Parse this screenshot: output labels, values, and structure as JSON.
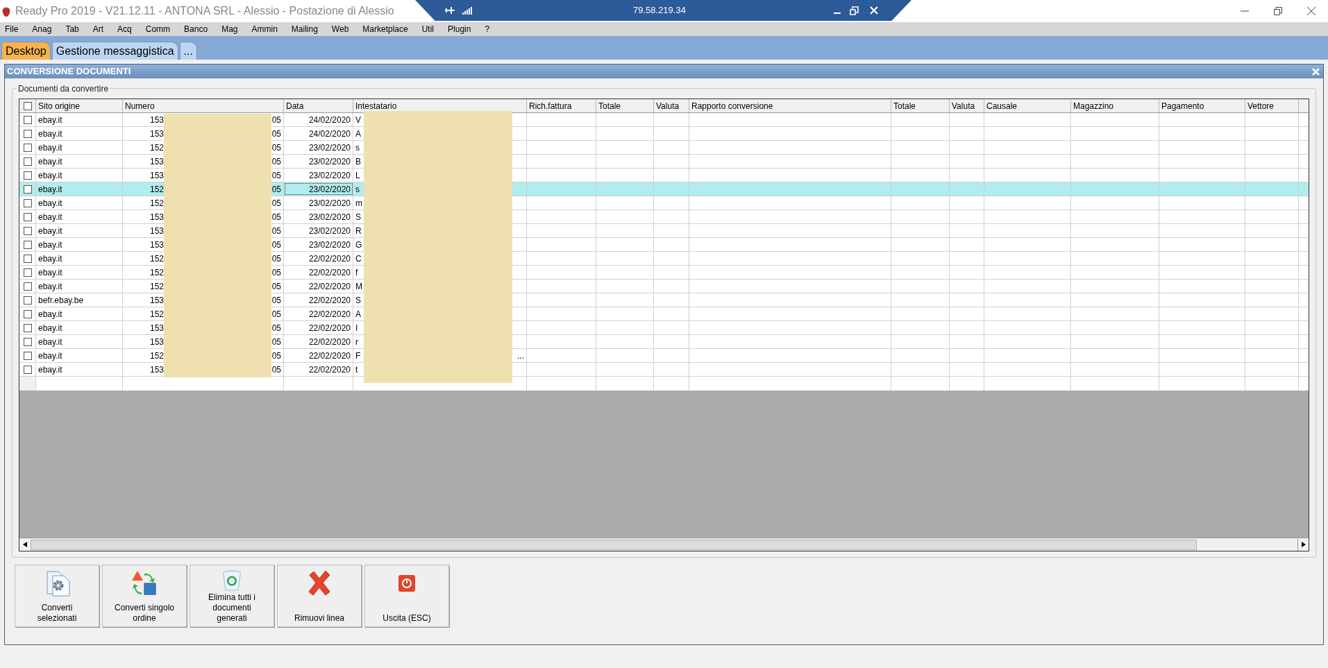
{
  "window": {
    "title": "Ready Pro 2019 - V21.12.11 - ANTONA SRL - Alessio - Postazione di Alessio"
  },
  "remote_bar": {
    "address": "79.58.219.34"
  },
  "menu": [
    "File",
    "Anag",
    "Tab",
    "Art",
    "Acq",
    "Comm",
    "Banco",
    "Mag",
    "Ammin",
    "Mailing",
    "Web",
    "Marketplace",
    "Util",
    "Plugin",
    "?"
  ],
  "tabs": [
    {
      "label": "Desktop",
      "selected": true
    },
    {
      "label": "Gestione messaggistica",
      "selected": false
    },
    {
      "label": "...",
      "selected": false
    }
  ],
  "panel": {
    "title": "CONVERSIONE DOCUMENTI",
    "group_label": "Documenti da convertire"
  },
  "table": {
    "header_checked": false,
    "columns": [
      "Sito origine",
      "Numero",
      "Data",
      "Intestatario",
      "Rich.fattura",
      "Totale",
      "Valuta",
      "Rapporto conversione",
      "Totale",
      "Valuta",
      "Causale",
      "Magazzino",
      "Pagamento",
      "Vettore"
    ],
    "rows": [
      {
        "checked": false,
        "selected": false,
        "focused": false,
        "sito_origine": "ebay.it",
        "numero_start": "153",
        "numero_end": "05",
        "data": "24/02/2020",
        "intestatario": "V"
      },
      {
        "checked": false,
        "selected": false,
        "focused": false,
        "sito_origine": "ebay.it",
        "numero_start": "153",
        "numero_end": "05",
        "data": "24/02/2020",
        "intestatario": "A"
      },
      {
        "checked": false,
        "selected": false,
        "focused": false,
        "sito_origine": "ebay.it",
        "numero_start": "152",
        "numero_end": "05",
        "data": "23/02/2020",
        "intestatario": "s"
      },
      {
        "checked": false,
        "selected": false,
        "focused": false,
        "sito_origine": "ebay.it",
        "numero_start": "153",
        "numero_end": "05",
        "data": "23/02/2020",
        "intestatario": "B"
      },
      {
        "checked": false,
        "selected": false,
        "focused": false,
        "sito_origine": "ebay.it",
        "numero_start": "153",
        "numero_end": "05",
        "data": "23/02/2020",
        "intestatario": "L"
      },
      {
        "checked": false,
        "selected": true,
        "focused": true,
        "sito_origine": "ebay.it",
        "numero_start": "152",
        "numero_end": "05",
        "data": "23/02/2020",
        "intestatario": "s"
      },
      {
        "checked": false,
        "selected": false,
        "focused": false,
        "sito_origine": "ebay.it",
        "numero_start": "152",
        "numero_end": "05",
        "data": "23/02/2020",
        "intestatario": "m"
      },
      {
        "checked": false,
        "selected": false,
        "focused": false,
        "sito_origine": "ebay.it",
        "numero_start": "153",
        "numero_end": "05",
        "data": "23/02/2020",
        "intestatario": "S"
      },
      {
        "checked": false,
        "selected": false,
        "focused": false,
        "sito_origine": "ebay.it",
        "numero_start": "153",
        "numero_end": "05",
        "data": "23/02/2020",
        "intestatario": "R"
      },
      {
        "checked": false,
        "selected": false,
        "focused": false,
        "sito_origine": "ebay.it",
        "numero_start": "153",
        "numero_end": "05",
        "data": "23/02/2020",
        "intestatario": "G"
      },
      {
        "checked": false,
        "selected": false,
        "focused": false,
        "sito_origine": "ebay.it",
        "numero_start": "152",
        "numero_end": "05",
        "data": "22/02/2020",
        "intestatario": "C"
      },
      {
        "checked": false,
        "selected": false,
        "focused": false,
        "sito_origine": "ebay.it",
        "numero_start": "152",
        "numero_end": "05",
        "data": "22/02/2020",
        "intestatario": "f"
      },
      {
        "checked": false,
        "selected": false,
        "focused": false,
        "sito_origine": "ebay.it",
        "numero_start": "152",
        "numero_end": "05",
        "data": "22/02/2020",
        "intestatario": "M"
      },
      {
        "checked": false,
        "selected": false,
        "focused": false,
        "sito_origine": "befr.ebay.be",
        "numero_start": "153",
        "numero_end": "05",
        "data": "22/02/2020",
        "intestatario": "S"
      },
      {
        "checked": false,
        "selected": false,
        "focused": false,
        "sito_origine": "ebay.it",
        "numero_start": "152",
        "numero_end": "05",
        "data": "22/02/2020",
        "intestatario": "A"
      },
      {
        "checked": false,
        "selected": false,
        "focused": false,
        "sito_origine": "ebay.it",
        "numero_start": "153",
        "numero_end": "05",
        "data": "22/02/2020",
        "intestatario": "I"
      },
      {
        "checked": false,
        "selected": false,
        "focused": false,
        "sito_origine": "ebay.it",
        "numero_start": "153",
        "numero_end": "05",
        "data": "22/02/2020",
        "intestatario": "r"
      },
      {
        "checked": false,
        "selected": false,
        "focused": false,
        "sito_origine": "ebay.it",
        "numero_start": "152",
        "numero_end": "05",
        "data": "22/02/2020",
        "intestatario": "F",
        "intestatario_end": "..."
      },
      {
        "checked": false,
        "selected": false,
        "focused": false,
        "sito_origine": "ebay.it",
        "numero_start": "153",
        "numero_end": "05",
        "data": "22/02/2020",
        "intestatario": "t"
      }
    ]
  },
  "buttons": [
    {
      "kind": "convert",
      "label": "Converti selezionati"
    },
    {
      "kind": "single",
      "label": "Converti singolo ordine"
    },
    {
      "kind": "delete",
      "label": "Elimina tutti i documenti generati"
    },
    {
      "kind": "remove",
      "label": "Rimuovi linea"
    },
    {
      "kind": "exit",
      "label": "Uscita (ESC)"
    }
  ]
}
